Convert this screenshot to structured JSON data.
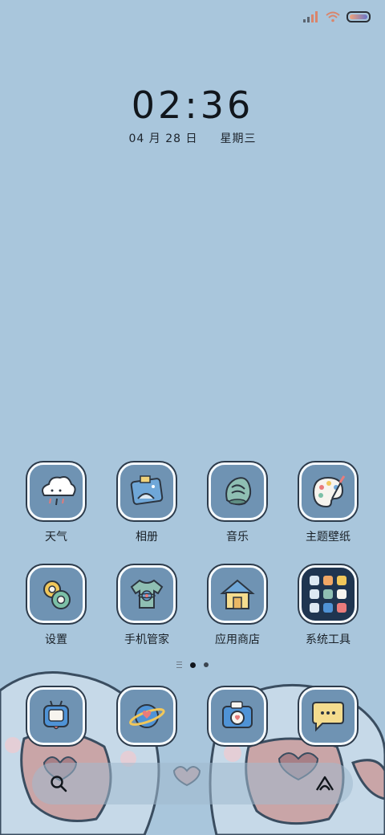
{
  "status_bar": {
    "icons": [
      "signal-icon",
      "wifi-icon",
      "battery-icon"
    ]
  },
  "clock": {
    "time": "02:36",
    "date": "04 月 28 日",
    "weekday": "星期三"
  },
  "apps_row1": [
    {
      "label": "天气",
      "icon": "weather-cloud-icon"
    },
    {
      "label": "相册",
      "icon": "photo-album-icon"
    },
    {
      "label": "音乐",
      "icon": "music-shell-icon"
    },
    {
      "label": "主题壁纸",
      "icon": "palette-icon"
    }
  ],
  "apps_row2": [
    {
      "label": "设置",
      "icon": "gears-icon"
    },
    {
      "label": "手机管家",
      "icon": "tshirt-icon"
    },
    {
      "label": "应用商店",
      "icon": "house-icon"
    },
    {
      "label": "系统工具",
      "icon": "app-folder-icon"
    }
  ],
  "dock": [
    {
      "icon": "tv-robot-icon"
    },
    {
      "icon": "planet-icon"
    },
    {
      "icon": "camera-icon"
    },
    {
      "icon": "chat-bubble-icon"
    }
  ],
  "colors": {
    "background": "#a9c6dc",
    "tile": "#6f93b3"
  }
}
